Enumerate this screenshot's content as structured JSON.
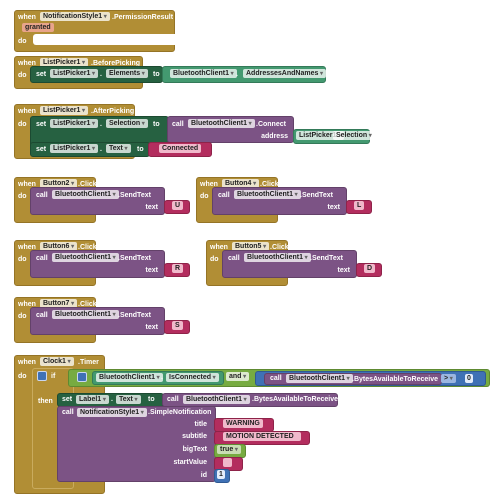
{
  "common": {
    "when": "when",
    "do": "do",
    "set": "set",
    "to": "to",
    "call": "call",
    "dot": ".",
    "quote": "\""
  },
  "colors": {
    "event": "#b18e35",
    "setter": "#266141",
    "getter": "#439970",
    "procedure": "#7c5385",
    "text": "#b32d5e",
    "logic": "#77ab41",
    "math": "#3f71b5"
  },
  "permission": {
    "component": "NotificationStyle1",
    "event": ".PermissionResult",
    "param": "granted"
  },
  "before_picking": {
    "component": "ListPicker1",
    "event": ".BeforePicking",
    "set_component": "ListPicker1",
    "set_property": "Elements",
    "get_component": "BluetoothClient1",
    "get_property": "AddressesAndNames"
  },
  "after_picking": {
    "component": "ListPicker1",
    "event": ".AfterPicking",
    "set1_component": "ListPicker1",
    "set1_property": "Selection",
    "call_component": "BluetoothClient1",
    "call_method": ".Connect",
    "arg_label": "address",
    "arg_component": "ListPicker1",
    "arg_property": "Selection",
    "set2_component": "ListPicker1",
    "set2_property": "Text",
    "set2_value": "Connected"
  },
  "buttons": [
    {
      "component": "Button2",
      "event": ".Click",
      "call_component": "BluetoothClient1",
      "method": ".SendText",
      "arg": "text",
      "value": "U"
    },
    {
      "component": "Button4",
      "event": ".Click",
      "call_component": "BluetoothClient1",
      "method": ".SendText",
      "arg": "text",
      "value": "L"
    },
    {
      "component": "Button6",
      "event": ".Click",
      "call_component": "BluetoothClient1",
      "method": ".SendText",
      "arg": "text",
      "value": "R"
    },
    {
      "component": "Button5",
      "event": ".Click",
      "call_component": "BluetoothClient1",
      "method": ".SendText",
      "arg": "text",
      "value": "D"
    },
    {
      "component": "Button7",
      "event": ".Click",
      "call_component": "BluetoothClient1",
      "method": ".SendText",
      "arg": "text",
      "value": "S"
    }
  ],
  "clock": {
    "component": "Clock1",
    "event": ".Timer",
    "if_label": "if",
    "then_label": "then",
    "cond_component": "BluetoothClient1",
    "cond_property": "IsConnected",
    "and_op": "and",
    "bytes_component": "BluetoothClient1",
    "bytes_method": ".BytesAvailableToReceive",
    "compare_op": ">",
    "compare_value": "0",
    "set_component": "Label1",
    "set_property": "Text",
    "set_call_component": "BluetoothClient1",
    "set_call_method": ".BytesAvailableToReceive",
    "notify_component": "NotificationStyle1",
    "notify_method": ".SimpleNotification",
    "args": {
      "title": "title",
      "subtitle": "subtitle",
      "bigText": "bigText",
      "startValue": "startValue",
      "id": "id"
    },
    "values": {
      "title": "WARNING",
      "subtitle": "MOTION DETECTED",
      "bigText": "true",
      "startValue": "",
      "id": "1"
    }
  }
}
